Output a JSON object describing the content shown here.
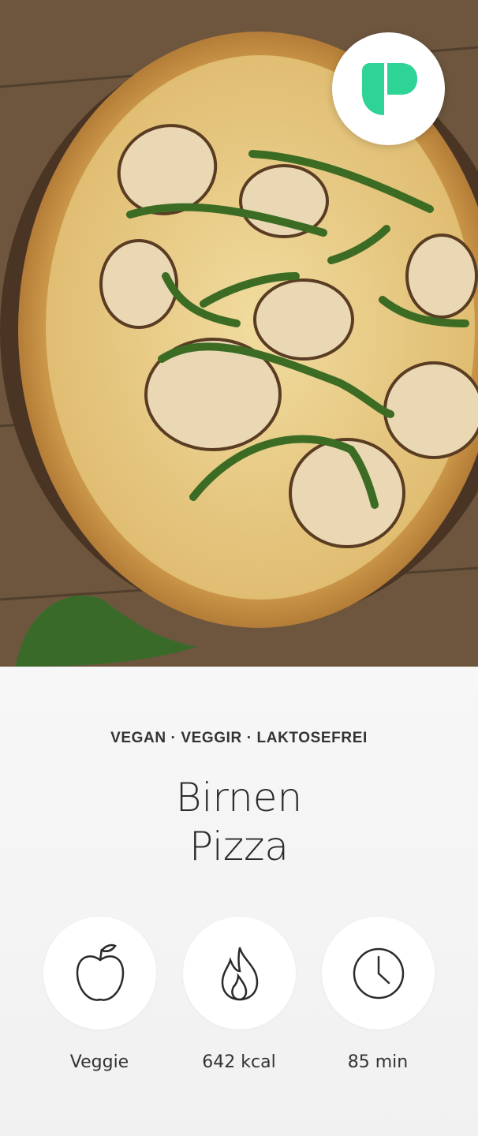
{
  "colors": {
    "brand": "#2ed396",
    "background": "#f3f3f3",
    "text": "#2b2b2b"
  },
  "header": {
    "logo_icon": "app-logo-icon",
    "image_subject": "pear pizza with arugula on wooden board"
  },
  "recipe": {
    "tags": "VEGAN · VEGGIR · LAKTOSEFREI",
    "title_line1": "Birnen",
    "title_line2": "Pizza"
  },
  "stats": [
    {
      "icon": "apple-icon",
      "label": "Veggie"
    },
    {
      "icon": "flame-icon",
      "label": "642 kcal"
    },
    {
      "icon": "clock-icon",
      "label": "85 min"
    }
  ]
}
